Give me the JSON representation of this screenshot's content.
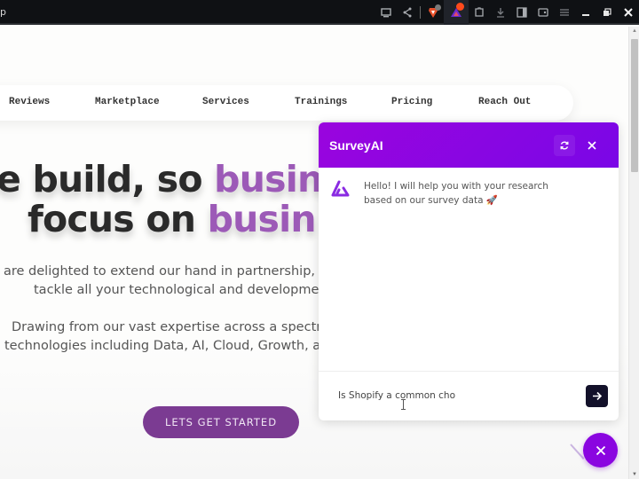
{
  "browser": {
    "tab_stub_text": "p",
    "toolbar_icons": [
      "cast-icon",
      "share-icon",
      "brave-shields-icon",
      "brave-rewards-icon",
      "extensions-icon",
      "downloads-icon",
      "sidebar-icon",
      "wallet-icon",
      "menu-icon",
      "minimize-icon",
      "restore-icon",
      "close-window-icon"
    ],
    "shields_badge_color": "#7a7a7a",
    "rewards_badge_color": "#ff4a1c"
  },
  "nav": {
    "items": [
      {
        "label": "Reviews"
      },
      {
        "label": "Marketplace"
      },
      {
        "label": "Services"
      },
      {
        "label": "Trainings"
      },
      {
        "label": "Pricing"
      },
      {
        "label": "Reach Out"
      }
    ]
  },
  "hero": {
    "line1_plain": "e build, so ",
    "line1_highlight": "busin",
    "line2_plain": "focus on ",
    "line2_highlight": "busin",
    "para1_line1": "are delighted to extend our hand in partnership, co",
    "para1_line2": "tackle all your technological and developmen",
    "para2_line1": "Drawing from our vast expertise across a spectrum",
    "para2_line2": "technologies including Data, AI, Cloud, Growth, an",
    "cta_label": "LETS GET STARTED",
    "accent_color": "#9c5ab7",
    "cta_color": "#7b3b92"
  },
  "chat": {
    "title": "SurveyAI",
    "header_color": "#8a05e0",
    "refresh_icon": "refresh-icon",
    "close_icon": "close-icon",
    "messages": [
      {
        "sender": "bot",
        "text": "Hello! I will help you with your research based on our survey data 🚀"
      }
    ],
    "input_value": "Is Shopify a common cho",
    "send_icon": "arrow-right-icon"
  },
  "fab": {
    "icon": "close-icon"
  }
}
